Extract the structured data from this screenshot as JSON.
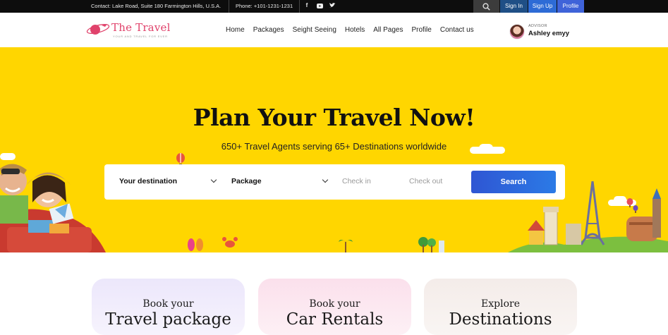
{
  "topbar": {
    "contact": "Contact: Lake Road, Suite 180 Farmington Hills, U.S.A.",
    "phone": "Phone: +101-1231-1231",
    "social": [
      "facebook-icon",
      "youtube-icon",
      "twitter-icon"
    ],
    "sign_in": "Sign In",
    "sign_up": "Sign Up",
    "profile": "Profile"
  },
  "header": {
    "logo_title": "The Travel",
    "logo_tagline": "YOUR AND TRAVEL FOR EVER",
    "nav": [
      "Home",
      "Packages",
      "Seight Seeing",
      "Hotels",
      "All Pages",
      "Profile",
      "Contact us"
    ],
    "advisor_label": "ADVISOR",
    "advisor_name": "Ashley emyy"
  },
  "hero": {
    "title": "Plan Your Travel Now!",
    "subtitle": "650+ Travel Agents serving 65+ Destinations worldwide",
    "destination": "Your destination",
    "package": "Package",
    "check_in": "Check in",
    "check_out": "Check out",
    "search": "Search",
    "bg_color": "#ffd600"
  },
  "cards": [
    {
      "line1": "Book your",
      "line2": "Travel package"
    },
    {
      "line1": "Book your",
      "line2": "Car Rentals"
    },
    {
      "line1": "Explore",
      "line2": "Destinations"
    }
  ]
}
